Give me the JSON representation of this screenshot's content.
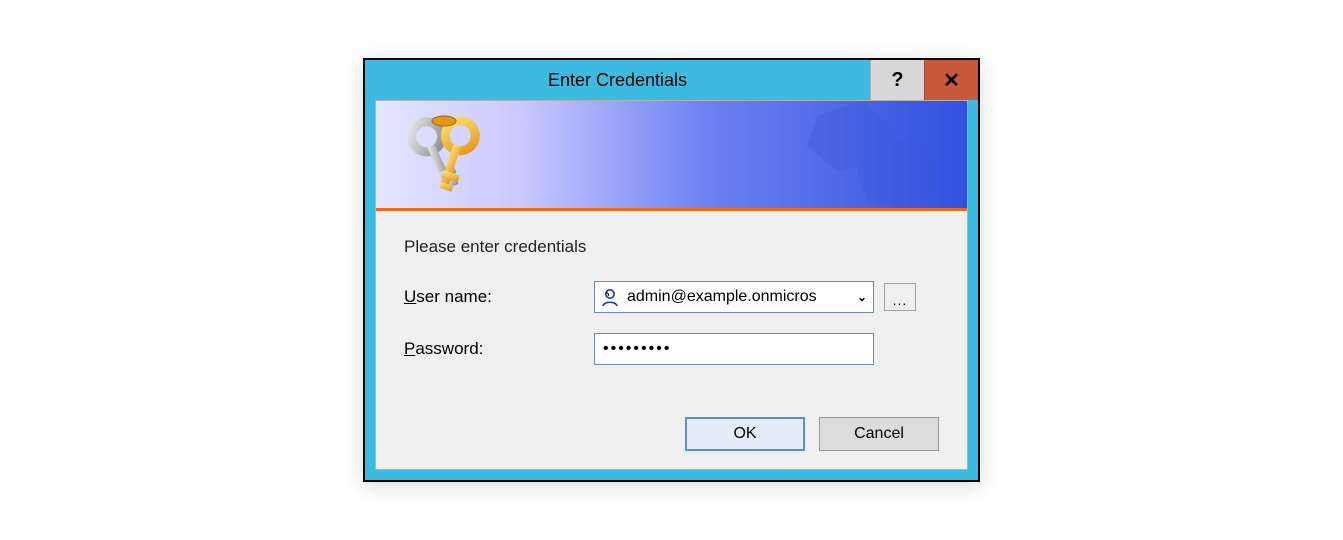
{
  "window": {
    "title": "Enter Credentials"
  },
  "form": {
    "prompt": "Please enter credentials",
    "username_label_pre": "U",
    "username_label_post": "ser name:",
    "username_value": "admin@example.onmicros",
    "password_label_pre": "P",
    "password_label_post": "assword:",
    "password_value": "•••••••••",
    "browse_label": "..."
  },
  "buttons": {
    "ok": "OK",
    "cancel": "Cancel"
  }
}
